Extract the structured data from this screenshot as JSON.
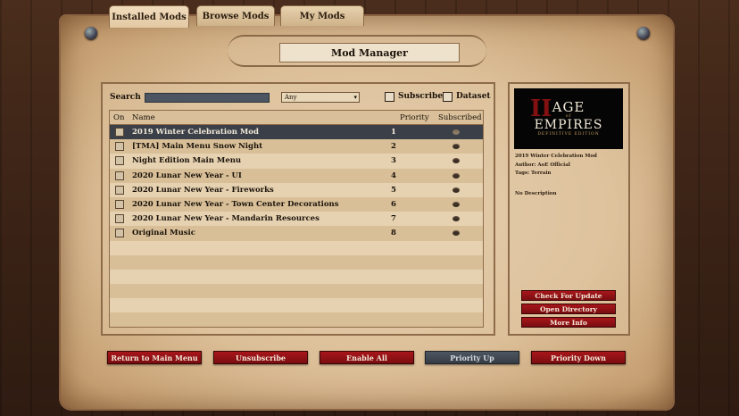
{
  "tabs": [
    {
      "label": "Installed Mods",
      "active": true
    },
    {
      "label": "Browse Mods",
      "active": false
    },
    {
      "label": "My Mods",
      "active": false
    }
  ],
  "title": "Mod Manager",
  "search": {
    "label": "Search",
    "value": ""
  },
  "filter": {
    "selected": "Any"
  },
  "checkboxes": {
    "subscribed": "Subscribed",
    "dataset": "Dataset"
  },
  "table": {
    "headers": {
      "on": "On",
      "name": "Name",
      "priority": "Priority",
      "subscribed": "Subscribed"
    },
    "rows": [
      {
        "name": "2019 Winter Celebration Mod",
        "priority": "1",
        "selected": true
      },
      {
        "name": "[TMA] Main Menu Snow Night",
        "priority": "2",
        "selected": false
      },
      {
        "name": "Night Edition Main Menu",
        "priority": "3",
        "selected": false
      },
      {
        "name": "2020 Lunar New Year - UI",
        "priority": "4",
        "selected": false
      },
      {
        "name": "2020 Lunar New Year - Fireworks",
        "priority": "5",
        "selected": false
      },
      {
        "name": "2020 Lunar New Year - Town Center Decorations",
        "priority": "6",
        "selected": false
      },
      {
        "name": "2020 Lunar New Year - Mandarin Resources",
        "priority": "7",
        "selected": false
      },
      {
        "name": "Original Music",
        "priority": "8",
        "selected": false
      }
    ]
  },
  "details": {
    "logo": {
      "line1": "AGE",
      "line2": "EMPIRES",
      "line3": "DEFINITIVE EDITION",
      "of": "of",
      "numeral": "II"
    },
    "name": "2019 Winter Celebration Mod",
    "author": "Author: AoE Official",
    "tags": "Tags: Terrain",
    "description": "No Description"
  },
  "side_buttons": {
    "check_update": "Check For Update",
    "open_dir": "Open Directory",
    "more_info": "More Info"
  },
  "bottom_buttons": {
    "return": "Return to Main Menu",
    "unsubscribe": "Unsubscribe",
    "enable_all": "Enable All",
    "priority_up": "Priority Up",
    "priority_down": "Priority Down"
  }
}
